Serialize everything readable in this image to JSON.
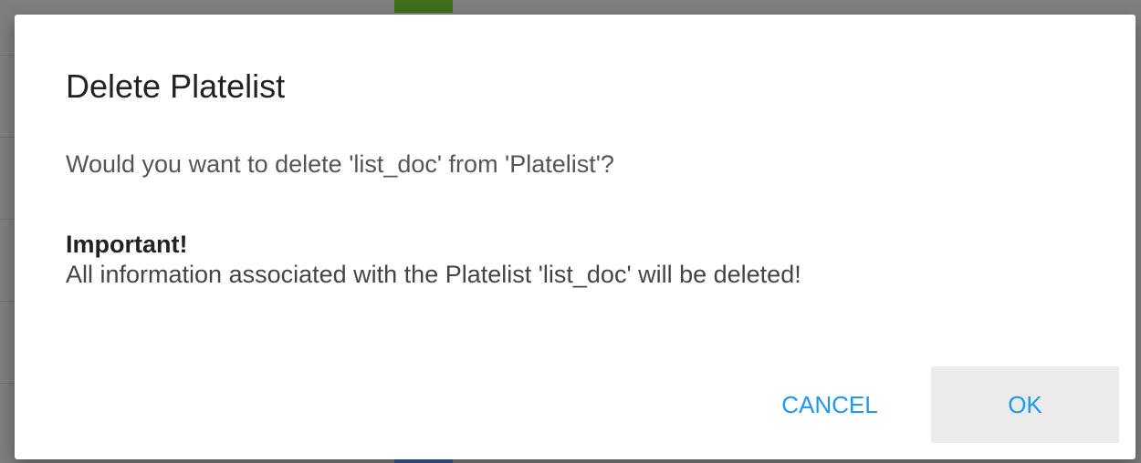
{
  "dialog": {
    "title": "Delete Platelist",
    "message": "Would you want to delete 'list_doc' from 'Platelist'?",
    "important_title": "Important!",
    "important_text": "All information associated with the Platelist 'list_doc' will be deleted!",
    "cancel_label": "CANCEL",
    "ok_label": "OK"
  },
  "colors": {
    "accent": "#2196f3",
    "ok_button_bg": "#ebebeb",
    "backdrop": "#7f7f7f"
  }
}
